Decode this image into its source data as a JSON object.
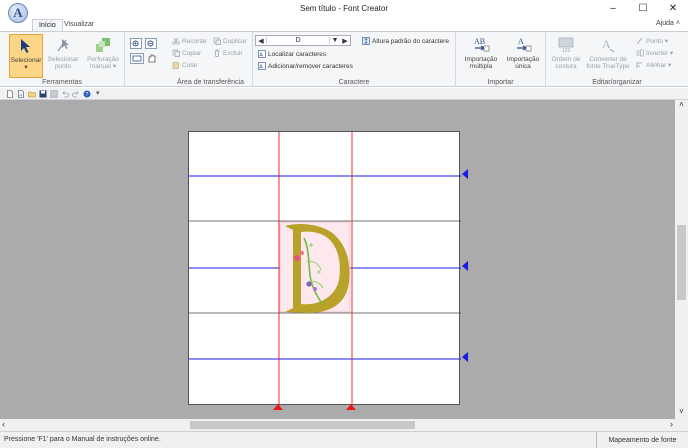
{
  "window": {
    "title": "Sem título - Font Creator",
    "minimize_label": "–",
    "maximize_label": "☐",
    "close_label": "✕"
  },
  "tabs": [
    {
      "label": "Início",
      "active": true
    },
    {
      "label": "Visualizar",
      "active": false
    }
  ],
  "help_label": "Ajuda",
  "help_arrow": "˄",
  "ribbon": {
    "ferramentas": {
      "label": "Ferramentas",
      "selecionar": "Selecionar",
      "selecionar_arrow": "▾",
      "selecionar_ponto_1": "Selecionar",
      "selecionar_ponto_2": "ponto",
      "perfuracao_1": "Perfuração",
      "perfuracao_2": "manual ▾"
    },
    "clipboard": {
      "label": "Área de transferência",
      "recortar": "Recortar",
      "duplicar": "Duplicar",
      "copiar": "Copiar",
      "excluir": "Excluir",
      "colar": "Colar"
    },
    "caractere": {
      "label": "Caractere",
      "current_char": "D",
      "altura": "Altura padrão do caractere",
      "localizar": "Localizar caracteres",
      "adicionar": "Adicionar/remover caracteres"
    },
    "importar": {
      "label": "Importar",
      "multipla_1": "Importação",
      "multipla_2": "múltipla",
      "unica_1": "Importação",
      "unica_2": "única"
    },
    "editar": {
      "label": "Editar/organizar",
      "ordem_1": "Ordem de",
      "ordem_2": "costura",
      "ordem_badge": "123",
      "converter_1": "Converter de",
      "converter_2": "fonte TrueType",
      "ponto": "Ponto ▾",
      "inverter": "Inverter ▾",
      "alinhar": "Alinhar ▾"
    }
  },
  "qat_more": "▾",
  "canvas": {
    "glyph": "D",
    "glyph_color": "#b8a22a"
  },
  "scroll": {
    "up": "˄",
    "down": "˅",
    "left": "‹",
    "right": "›"
  },
  "status": {
    "hint": "Pressione 'F1' para o Manual de instruções online.",
    "mode": "Mapeamento de fonte"
  },
  "colors": {
    "guide_blue": "#1a1ae6",
    "guide_red": "#e61a1a",
    "active_button": "#fcd586"
  }
}
